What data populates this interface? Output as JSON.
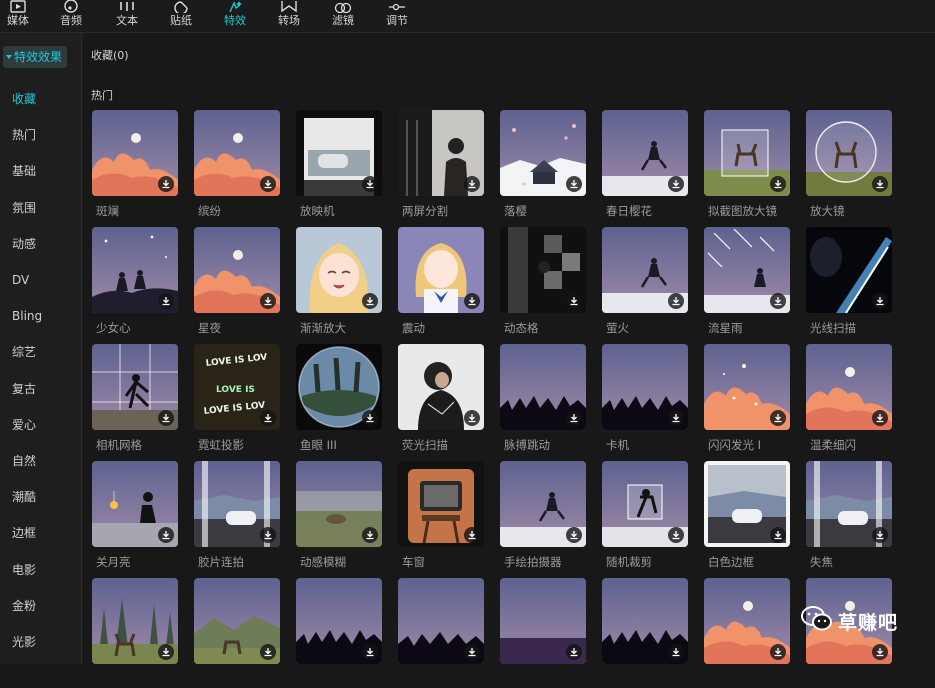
{
  "toolbar": {
    "tools": [
      {
        "label": "媒体",
        "icon": "media-icon"
      },
      {
        "label": "音频",
        "icon": "audio-icon"
      },
      {
        "label": "文本",
        "icon": "text-icon"
      },
      {
        "label": "贴纸",
        "icon": "sticker-icon"
      },
      {
        "label": "特效",
        "icon": "effects-icon",
        "active": true
      },
      {
        "label": "转场",
        "icon": "transition-icon"
      },
      {
        "label": "滤镜",
        "icon": "filter-icon"
      },
      {
        "label": "调节",
        "icon": "adjust-icon"
      }
    ]
  },
  "sidebar": {
    "header": "特效效果",
    "categories": [
      "收藏",
      "热门",
      "基础",
      "氛围",
      "动感",
      "DV",
      "Bling",
      "综艺",
      "复古",
      "爱心",
      "自然",
      "潮酷",
      "边框",
      "电影",
      "金粉",
      "光影"
    ],
    "active": "收藏"
  },
  "main": {
    "favorites_title": "收藏(0)",
    "hot_title": "热门",
    "items": [
      {
        "name": "斑斓",
        "scene": "sunset-clouds"
      },
      {
        "name": "缤纷",
        "scene": "sunset-clouds"
      },
      {
        "name": "放映机",
        "scene": "projector"
      },
      {
        "name": "两屏分割",
        "scene": "split-person"
      },
      {
        "name": "落樱",
        "scene": "house-sakura"
      },
      {
        "name": "春日樱花",
        "scene": "jump-sky"
      },
      {
        "name": "拟截图放大镜",
        "scene": "deer-frame"
      },
      {
        "name": "放大镜",
        "scene": "deer-circle"
      },
      {
        "name": "少女心",
        "scene": "couple-night"
      },
      {
        "name": "星夜",
        "scene": "sunset-clouds"
      },
      {
        "name": "渐渐放大",
        "scene": "anime-girl"
      },
      {
        "name": "震动",
        "scene": "anime-girl-bow"
      },
      {
        "name": "动态格",
        "scene": "dark-grid"
      },
      {
        "name": "萤火",
        "scene": "jump-sky"
      },
      {
        "name": "流星雨",
        "scene": "meteor"
      },
      {
        "name": "光线扫描",
        "scene": "light-scan"
      },
      {
        "name": "相机网格",
        "scene": "camera-grid"
      },
      {
        "name": "霓虹投影",
        "scene": "neon-text"
      },
      {
        "name": "鱼眼 III",
        "scene": "fisheye"
      },
      {
        "name": "荧光扫描",
        "scene": "hoodie"
      },
      {
        "name": "脉搏跳动",
        "scene": "concert"
      },
      {
        "name": "卡机",
        "scene": "concert"
      },
      {
        "name": "闪闪发光 I",
        "scene": "sunset-sparkle"
      },
      {
        "name": "温柔细闪",
        "scene": "sunset-clouds"
      },
      {
        "name": "关月亮",
        "scene": "moon-girl"
      },
      {
        "name": "胶片连拍",
        "scene": "car-strips"
      },
      {
        "name": "动感模糊",
        "scene": "blur-field"
      },
      {
        "name": "车窗",
        "scene": "tv"
      },
      {
        "name": "手绘拍摄器",
        "scene": "jump-sky"
      },
      {
        "name": "随机裁剪",
        "scene": "jump-frame"
      },
      {
        "name": "白色边框",
        "scene": "car-white-border"
      },
      {
        "name": "失焦",
        "scene": "car-strips"
      },
      {
        "name": "",
        "scene": "deer-forest"
      },
      {
        "name": "",
        "scene": "deer-field"
      },
      {
        "name": "",
        "scene": "concert"
      },
      {
        "name": "",
        "scene": "rainbow-concert"
      },
      {
        "name": "",
        "scene": "concert-blur"
      },
      {
        "name": "",
        "scene": "concert"
      },
      {
        "name": "",
        "scene": "sunset-clouds"
      },
      {
        "name": "",
        "scene": "sunset-clouds"
      }
    ]
  },
  "watermark": {
    "text": "草赚吧",
    "icon": "wechat-icon"
  },
  "colors": {
    "accent": "#1fc8d8",
    "background": "#181818",
    "sidebar": "#1e1e1e"
  }
}
